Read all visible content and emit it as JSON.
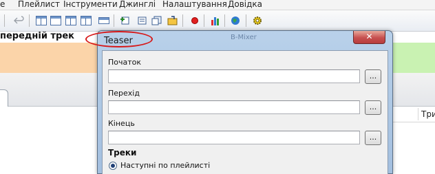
{
  "menu": {
    "playlist": "Плейлист",
    "tools": "Інструменти",
    "jingles": "Джинглі",
    "settings": "Налаштування",
    "help": "Довідка"
  },
  "toolbar": {
    "icons": [
      "undo-icon",
      "window-single-icon",
      "window-split-icon",
      "window-split-icon",
      "window-small-icon",
      "add-track-icon",
      "add-folder-icon",
      "add-files-icon",
      "add-playlist-icon",
      "record-icon",
      "equalizer-icon",
      "globe-icon",
      "gear-icon"
    ]
  },
  "background": {
    "prev_track_label": "передній трек",
    "column_header": "Три"
  },
  "dialog": {
    "title": "Teaser",
    "ghost_title": "B-Mixer",
    "close_label": "✕",
    "start_label": "Початок",
    "start_value": "",
    "transition_label": "Перехід",
    "transition_value": "",
    "end_label": "Кінець",
    "end_value": "",
    "browse_label": "...",
    "tracks_section": "Треки",
    "radio_next": "Наступні по плейлисті"
  },
  "colors": {
    "annotation": "#d71919",
    "orange_band": "#fbd4a9",
    "green_band": "#c9f2b2"
  }
}
